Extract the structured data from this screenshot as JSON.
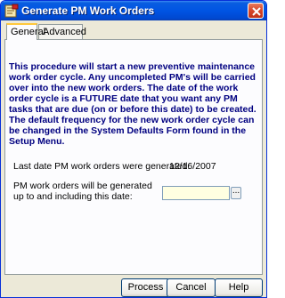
{
  "window": {
    "title": "Generate PM Work Orders",
    "close_icon": "close-icon",
    "app_icon": "work-order-app-icon"
  },
  "tabs": [
    {
      "label": "General",
      "active": true
    },
    {
      "label": "Advanced",
      "active": false
    }
  ],
  "general": {
    "intro_text": "This procedure will start a new preventive maintenance work order cycle. Any uncompleted PM's will be carried over into the new work orders. The date of the work order cycle is a FUTURE date that you want any PM tasks that are due (on or before this date) to be created. The default frequency for the new work order cycle can be changed in the System Defaults Form found in the Setup Menu.",
    "last_generated_label": "Last date PM work orders were generated:",
    "last_generated_value": "12/16/2007",
    "generate_up_to_label": "PM work orders will be generated up to and including this date:",
    "generate_up_to_value": "",
    "date_picker_label": "..."
  },
  "buttons": {
    "process": "Process",
    "cancel": "Cancel",
    "help": "Help"
  },
  "colors": {
    "titlebar": "#0054e3",
    "intro_text": "#000080",
    "date_field_bg": "#ffffe1"
  }
}
